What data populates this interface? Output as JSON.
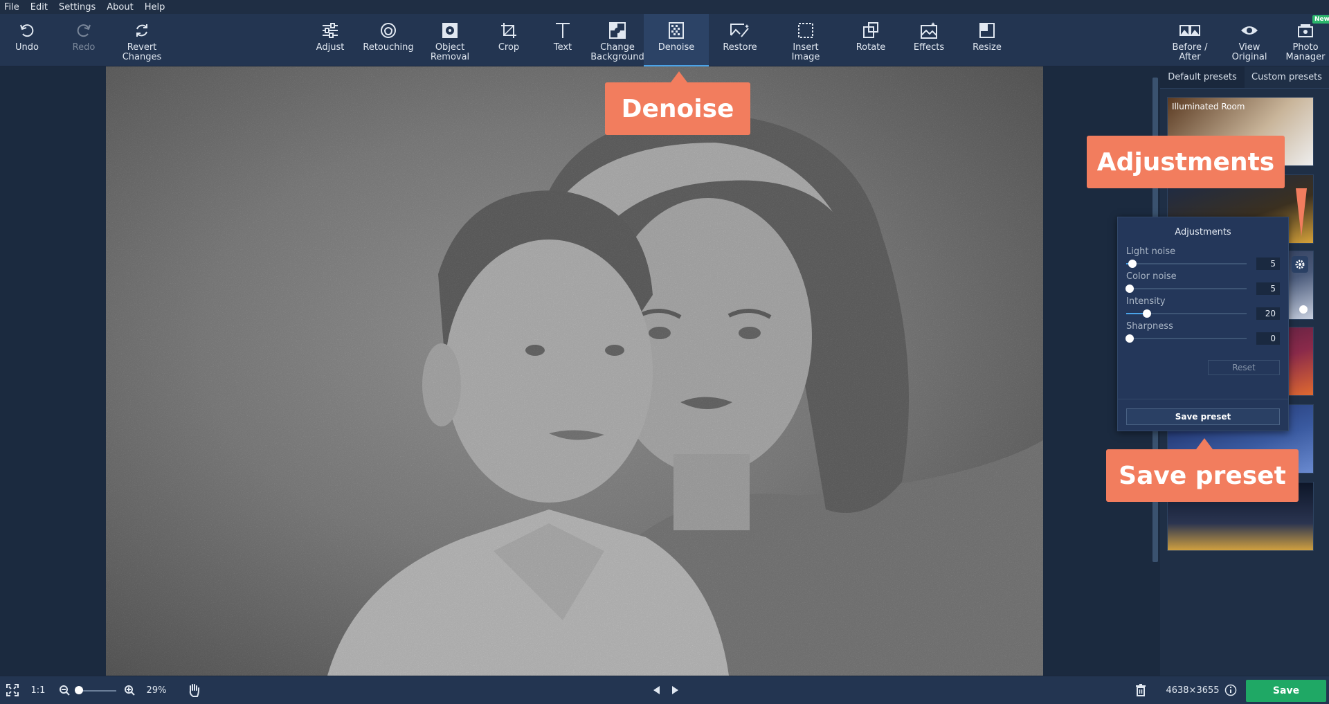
{
  "menu": [
    "File",
    "Edit",
    "Settings",
    "About",
    "Help"
  ],
  "toolbar": {
    "undo": "Undo",
    "redo": "Redo",
    "revert": "Revert\nChanges",
    "adjust": "Adjust",
    "retouching": "Retouching",
    "object_removal": "Object\nRemoval",
    "crop": "Crop",
    "text": "Text",
    "change_background": "Change\nBackground",
    "denoise": "Denoise",
    "restore": "Restore",
    "insert_image": "Insert\nImage",
    "rotate": "Rotate",
    "effects": "Effects",
    "resize": "Resize",
    "before_after": "Before /\nAfter",
    "view_original": "View\nOriginal",
    "photo_manager": "Photo\nManager",
    "new_badge": "New"
  },
  "panel": {
    "tabs": [
      "Default presets",
      "Custom presets"
    ],
    "active_tab": 0,
    "presets": [
      {
        "label": "Illuminated Room"
      },
      {
        "label": ""
      },
      {
        "label": ""
      },
      {
        "label": ""
      },
      {
        "label": ""
      },
      {
        "label": ""
      }
    ]
  },
  "adjustments": {
    "title": "Adjustments",
    "sliders": [
      {
        "label": "Light noise",
        "value": "5",
        "fraction": 0.05
      },
      {
        "label": "Color noise",
        "value": "5",
        "fraction": 0.03
      },
      {
        "label": "Intensity",
        "value": "20",
        "fraction": 0.17
      },
      {
        "label": "Sharpness",
        "value": "0",
        "fraction": 0.03
      }
    ],
    "reset": "Reset",
    "save_preset": "Save preset"
  },
  "callouts": {
    "denoise": "Denoise",
    "adjustments": "Adjustments",
    "save_preset": "Save preset"
  },
  "status": {
    "ratio": "1:1",
    "zoom": "29%",
    "dimensions": "4638×3655",
    "save": "Save"
  },
  "colors": {
    "accent": "#4aa3e8",
    "callout": "#f27d5e",
    "save": "#1fa865"
  }
}
